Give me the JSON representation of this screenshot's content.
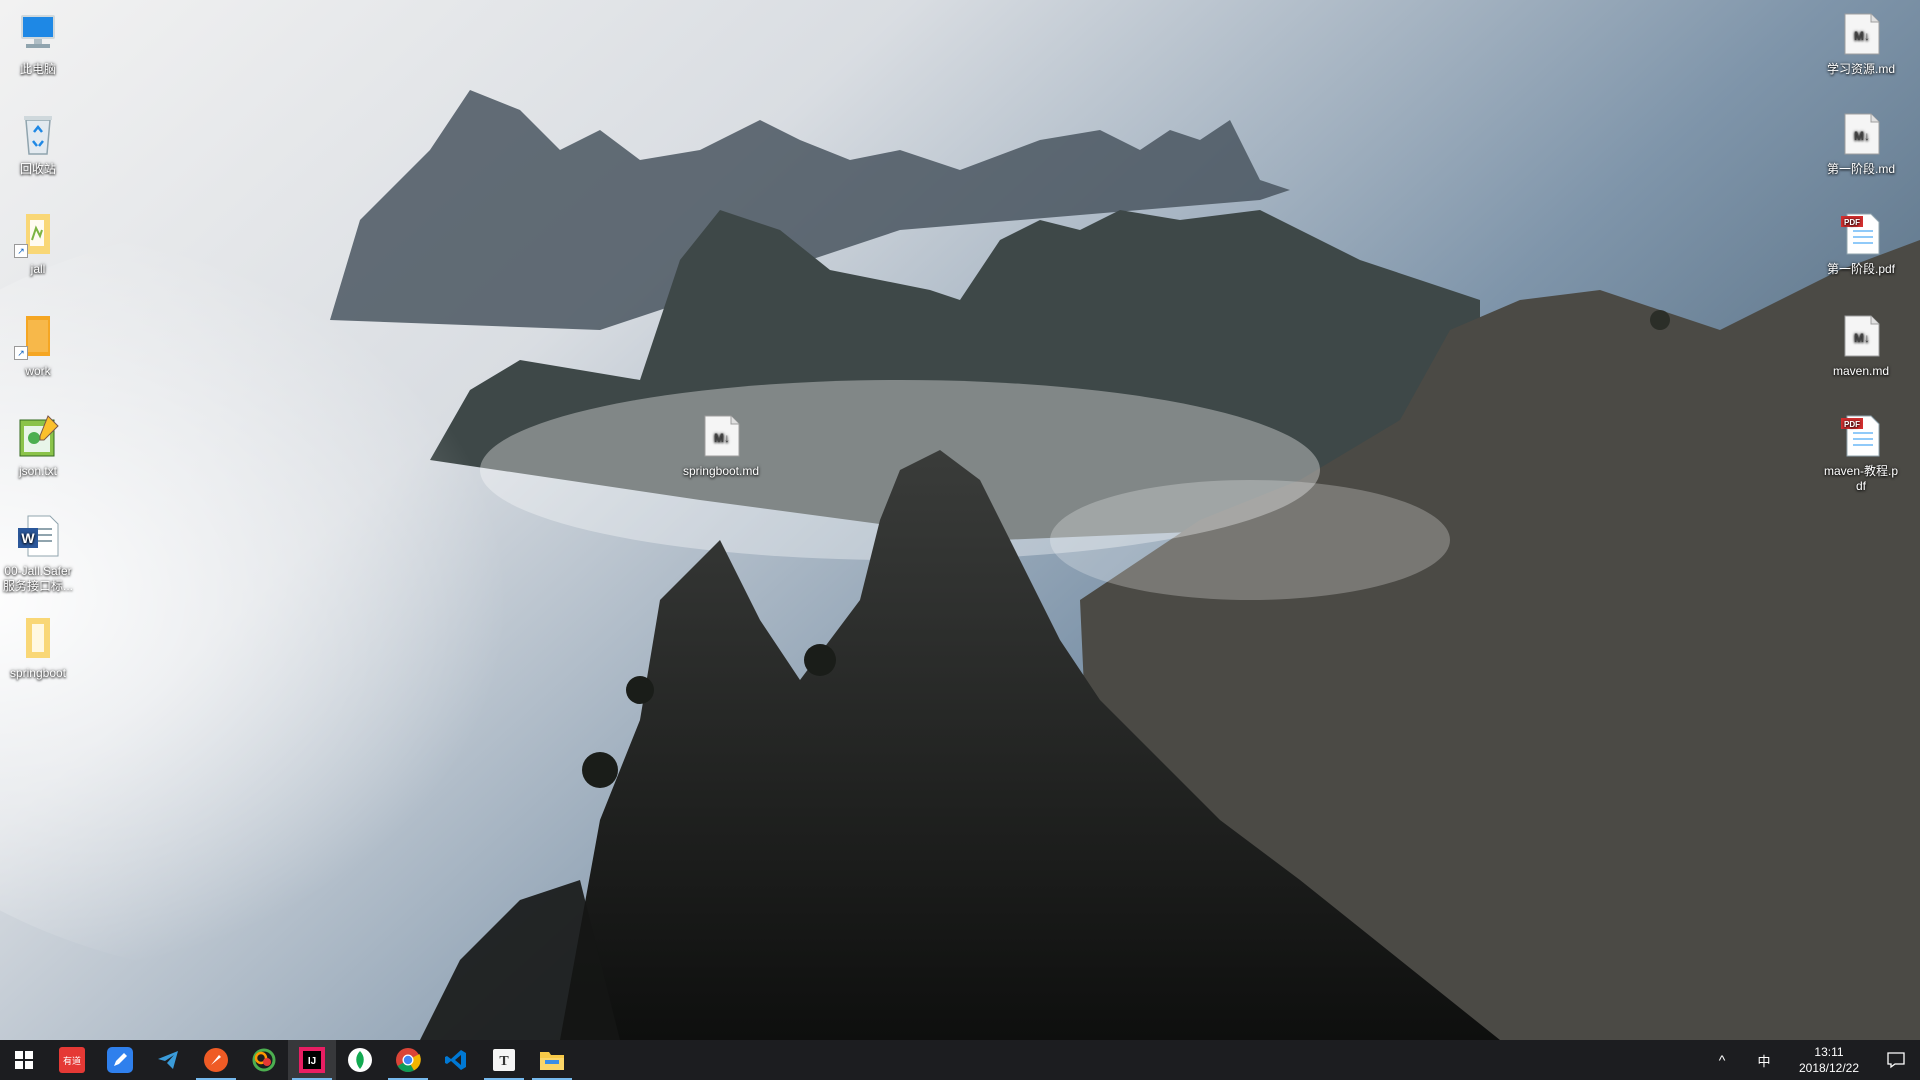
{
  "desktop": {
    "left_icons": [
      {
        "label": "此电脑",
        "icon": "computer-icon"
      },
      {
        "label": "回收站",
        "icon": "recycle-bin-icon"
      },
      {
        "label": "jall",
        "icon": "folder-shortcut-icon"
      },
      {
        "label": "work",
        "icon": "folder-shortcut-icon"
      },
      {
        "label": "json.txt",
        "icon": "notepad-file-icon"
      },
      {
        "label": "00-Jall.Safer服务接口标...",
        "icon": "word-document-icon"
      },
      {
        "label": "springboot",
        "icon": "folder-icon"
      }
    ],
    "center_icon": {
      "label": "springboot.md",
      "icon": "markdown-file-icon"
    },
    "right_icons": [
      {
        "label": "学习资源.md",
        "icon": "markdown-file-icon"
      },
      {
        "label": "第一阶段.md",
        "icon": "markdown-file-icon"
      },
      {
        "label": "第一阶段.pdf",
        "icon": "pdf-file-icon"
      },
      {
        "label": "maven.md",
        "icon": "markdown-file-icon"
      },
      {
        "label": "maven-教程.pdf",
        "icon": "pdf-file-icon"
      }
    ],
    "markdown_badge": "M↓",
    "pdf_badge": "PDF"
  },
  "taskbar": {
    "apps": [
      {
        "name": "start",
        "icon": "windows-start-icon"
      },
      {
        "name": "youdao-dictionary",
        "icon": "youdao-icon",
        "badge": "有道"
      },
      {
        "name": "notes",
        "icon": "pen-note-icon"
      },
      {
        "name": "telegram",
        "icon": "paper-plane-icon"
      },
      {
        "name": "postman",
        "icon": "postman-icon"
      },
      {
        "name": "navicat",
        "icon": "navicat-icon"
      },
      {
        "name": "intellij-idea",
        "icon": "intellij-icon",
        "badge": "IJ"
      },
      {
        "name": "mongodb-compass",
        "icon": "leaf-icon"
      },
      {
        "name": "chrome",
        "icon": "chrome-icon"
      },
      {
        "name": "vscode",
        "icon": "vscode-icon"
      },
      {
        "name": "typora",
        "icon": "typora-icon",
        "badge": "T"
      },
      {
        "name": "file-explorer",
        "icon": "folder-icon"
      }
    ],
    "tray": {
      "chevron": "^",
      "ime": "中",
      "time": "13:11",
      "date": "2018/12/22",
      "notification_icon": "notification-icon"
    }
  },
  "colors": {
    "taskbar_bg": "#1c1d20",
    "running_indicator": "#76b9ed"
  }
}
